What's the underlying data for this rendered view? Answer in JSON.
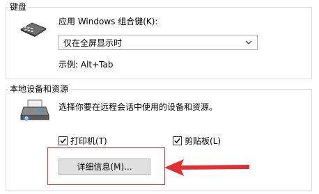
{
  "keyboard": {
    "group_title": "键盘",
    "apply_label": "应用 Windows 组合键(K):",
    "dropdown_value": "仅在全屏显示时",
    "example_label": "示例: Alt+Tab",
    "icon": "keyboard-icon"
  },
  "local": {
    "group_title": "本地设备和资源",
    "description": "选择你要在远程会话中使用的设备和资源。",
    "printer_label": "打印机(T)",
    "printer_checked": true,
    "clipboard_label": "剪贴板(L)",
    "clipboard_checked": true,
    "more_button_label": "详细信息(M)...",
    "icon": "devices-icon"
  },
  "annotation": {
    "highlight_color": "#e23b3b",
    "arrow_color": "#e03030"
  }
}
